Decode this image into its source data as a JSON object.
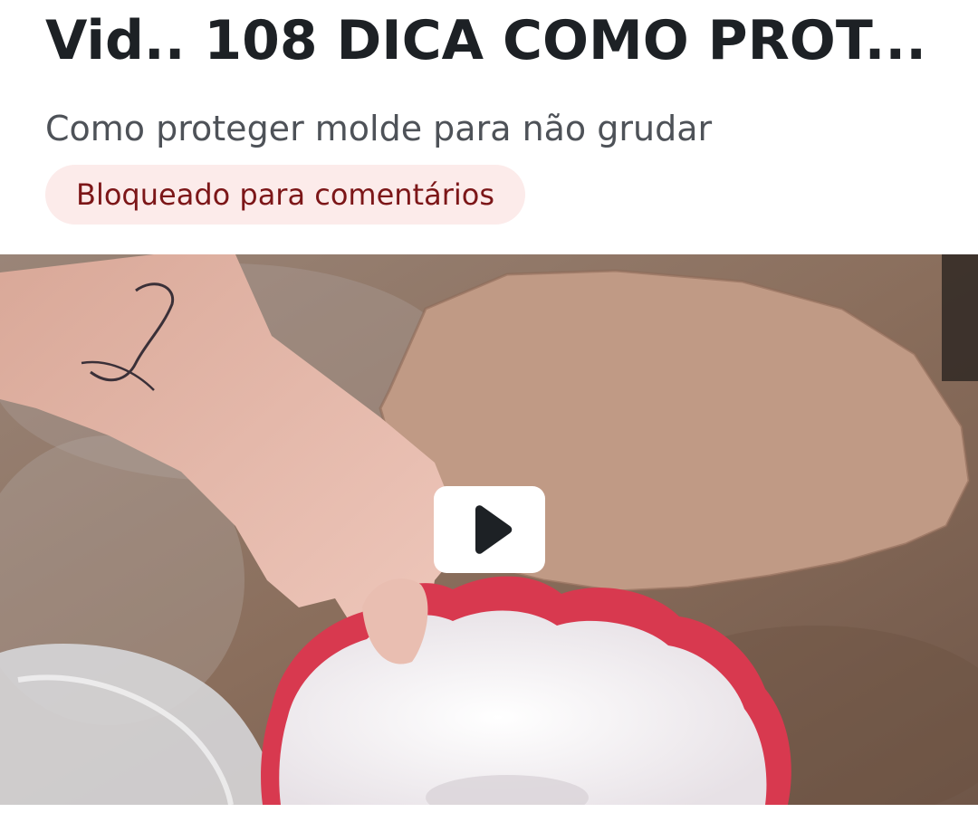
{
  "post": {
    "title": "Vid.. 108 DICA COMO PROT...",
    "subtitle": "Como proteger molde para não grudar",
    "badge": "Bloqueado para comentários"
  },
  "video": {
    "play_icon": "play-icon",
    "colors": {
      "table": "#8a6f5d",
      "clay": "#c09a85",
      "bowl_rim": "#d8394f",
      "bowl": "#f2eef0",
      "skin": "#e2b3a6"
    }
  },
  "colors": {
    "title": "#1d2125",
    "subtitle": "#4e5258",
    "badge_bg": "#fcebea",
    "badge_text": "#7c1618"
  }
}
